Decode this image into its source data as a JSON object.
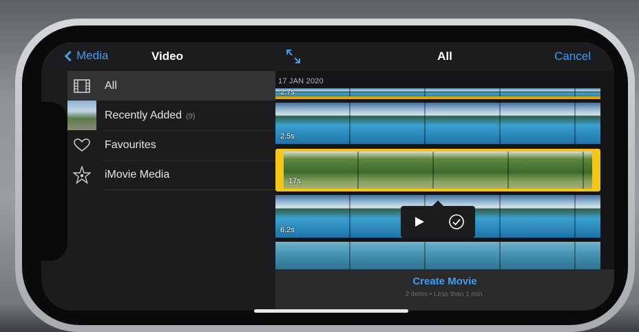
{
  "left_panel": {
    "back_label": "Media",
    "title": "Video",
    "items": [
      {
        "label": "All",
        "count": ""
      },
      {
        "label": "Recently Added",
        "count": "(9)"
      },
      {
        "label": "Favourites",
        "count": ""
      },
      {
        "label": "iMovie Media",
        "count": ""
      }
    ]
  },
  "right_panel": {
    "title": "All",
    "cancel_label": "Cancel",
    "date": "17 JAN 2020",
    "clips": [
      {
        "duration": "2.7s"
      },
      {
        "duration": "2.5s"
      },
      {
        "duration": "17s"
      },
      {
        "duration": "6.2s"
      },
      {
        "duration": ""
      }
    ],
    "create_label": "Create Movie",
    "create_sub": "2 items • Less than 1 min."
  },
  "icons": {
    "back": "chevron-left-icon",
    "expand": "expand-arrows-icon",
    "all": "film-icon",
    "favourites": "heart-icon",
    "imovie": "star-icon",
    "play": "play-icon",
    "check": "check-circle-icon"
  },
  "colors": {
    "accent": "#3d9ef0",
    "selection": "#f5c518"
  }
}
